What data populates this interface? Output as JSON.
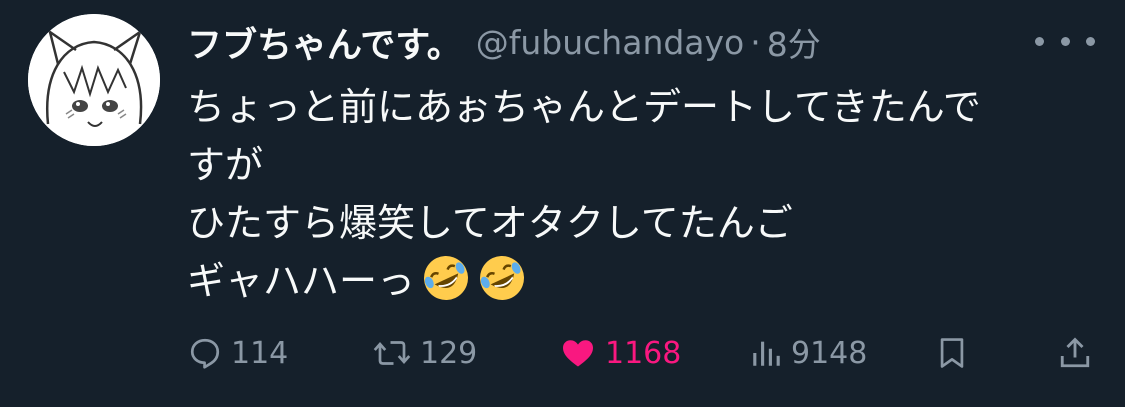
{
  "tweet": {
    "display_name": "フブちゃんです。",
    "handle": "@fubuchandayo",
    "separator": "·",
    "time": "8分",
    "lines": [
      "ちょっと前にあぉちゃんとデートしてきたんで",
      "すが",
      "ひたすら爆笑してオタクしてたんご",
      "ギャハハーっ"
    ],
    "emoji": [
      "rolling-on-floor-laughing",
      "rolling-on-floor-laughing"
    ]
  },
  "actions": {
    "replies": "114",
    "retweets": "129",
    "likes": "1168",
    "views": "9148"
  },
  "colors": {
    "background": "#15202b",
    "text": "#f7f9f9",
    "secondary": "#8b98a5",
    "like": "#f91880"
  },
  "icons": [
    "avatar-image",
    "more-icon",
    "reply-icon",
    "retweet-icon",
    "heart-icon",
    "views-icon",
    "bookmark-icon",
    "share-icon"
  ]
}
